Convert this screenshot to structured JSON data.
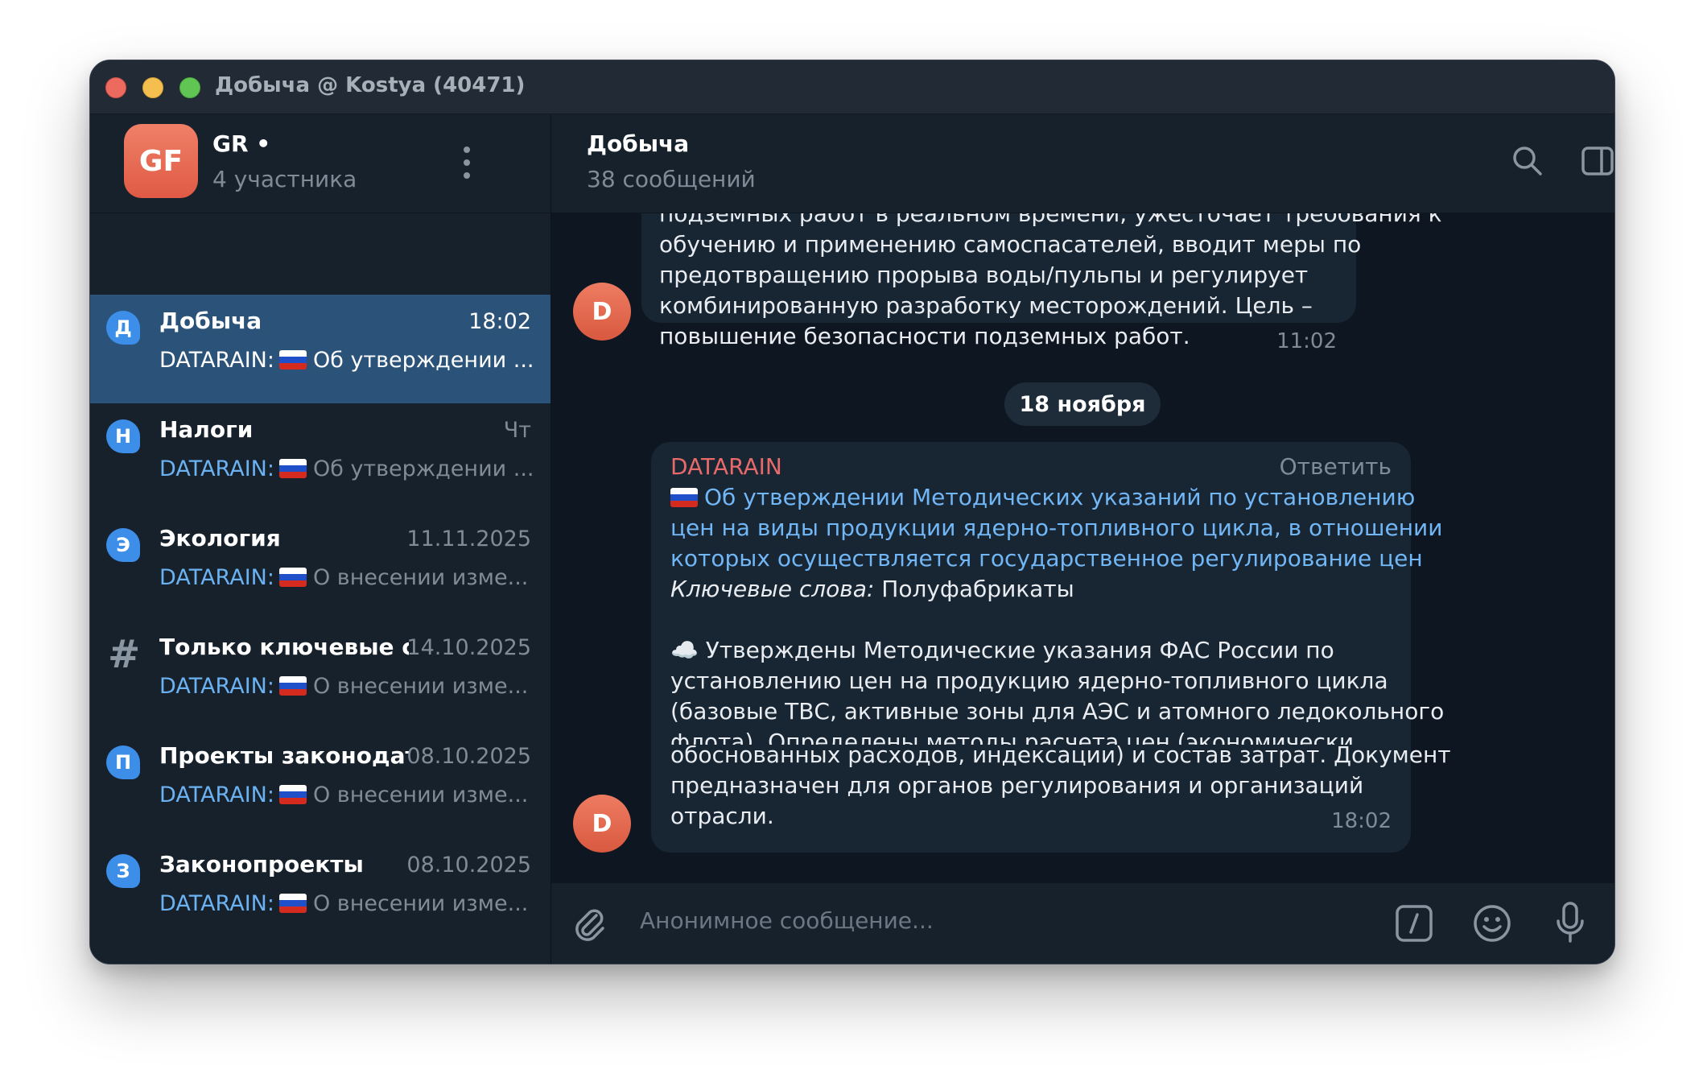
{
  "window": {
    "title": "Добыча @ Kostya (40471)"
  },
  "group": {
    "avatar_initials": "GF",
    "name": "GR •",
    "members": "4 участника"
  },
  "chats": [
    {
      "avatar": "Д",
      "name": "Добыча",
      "time": "18:02",
      "sender": "DATARAIN:",
      "preview": "Об утверждении ...",
      "active": true
    },
    {
      "avatar": "Н",
      "name": "Налоги",
      "time": "Чт",
      "sender": "DATARAIN:",
      "preview": "Об утверждении ..."
    },
    {
      "avatar": "Э",
      "name": "Экология",
      "time": "11.11.2025",
      "sender": "DATARAIN:",
      "preview": "О внесении изме..."
    },
    {
      "avatar": "#",
      "name": "Только ключевые с...",
      "time": "14.10.2025",
      "sender": "DATARAIN:",
      "preview": "О внесении изме..."
    },
    {
      "avatar": "П",
      "name": "Проекты законодат...",
      "time": "08.10.2025",
      "sender": "DATARAIN:",
      "preview": "О внесении изме..."
    },
    {
      "avatar": "З",
      "name": "Законопроекты",
      "time": "08.10.2025",
      "sender": "DATARAIN:",
      "preview": "О внесении изме..."
    }
  ],
  "header": {
    "title": "Добыча",
    "subtitle": "38 сообщений"
  },
  "messages": {
    "first": {
      "avatar": "D",
      "lines": [
        "подземных работ в реальном времени, ужесточает требования к",
        "обучению и применению самоспасателей, вводит меры по",
        "предотвращению прорыва воды/пульпы и регулирует",
        "комбинированную разработку месторождений. Цель –",
        "повышение безопасности подземных работ."
      ],
      "time": "11:02"
    },
    "date_separator": "18 ноября",
    "second": {
      "avatar": "D",
      "sender": "DATARAIN",
      "reply": "Ответить",
      "link_lines": [
        "Об утверждении Методических указаний по установлению",
        "цен на виды продукции ядерно-топливного цикла, в отношении",
        "которых осуществляется государственное регулирование цен"
      ],
      "keywords_label": "Ключевые слова:",
      "keywords": "Полуфабрикаты",
      "cloud": "☁️",
      "body_lines": [
        "Утверждены Методические указания ФАС России по",
        "установлению цен на продукцию ядерно-топливного цикла",
        "(базовые ТВС, активные зоны для АЭС и атомного ледокольного",
        "флота). Определены методы расчета цен (экономически",
        "обоснованных расходов, индексации) и состав затрат. Документ",
        "предназначен для органов регулирования и организаций",
        "отрасли."
      ],
      "time": "18:02"
    }
  },
  "composer": {
    "placeholder": "Анонимное сообщение..."
  },
  "colors": {
    "accent": "#2b5278",
    "link": "#71b6f5",
    "sender": "#e66a6a",
    "avatar": "#3c8ee8"
  }
}
